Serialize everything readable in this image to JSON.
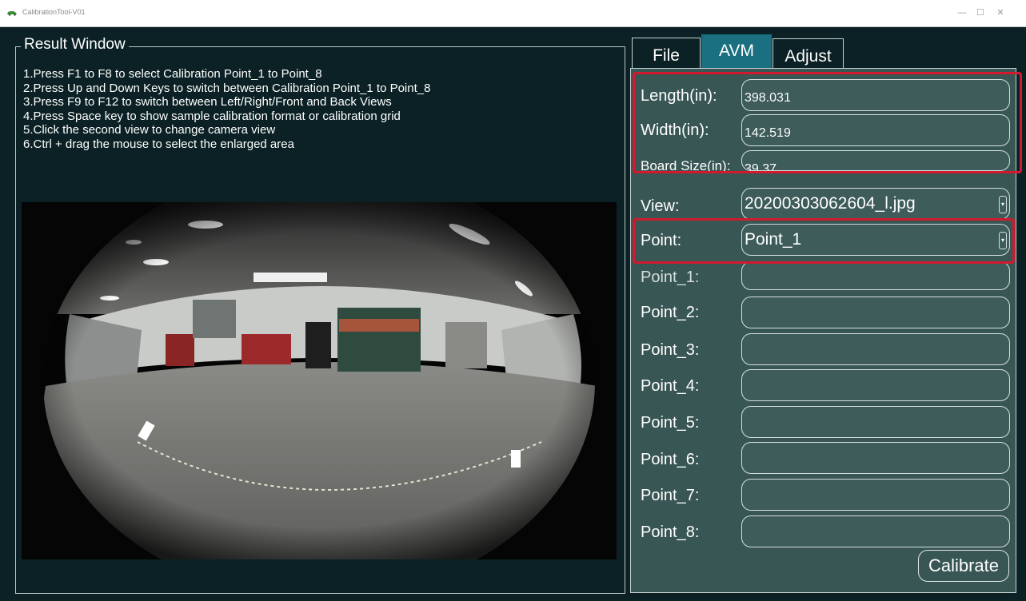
{
  "window": {
    "title": "CalibrationTool-V01",
    "minimize_glyph": "—",
    "maximize_glyph": "☐",
    "close_glyph": "✕"
  },
  "result": {
    "title": "Result Window",
    "instructions": [
      "1.Press F1 to F8 to select Calibration Point_1 to Point_8",
      "2.Press Up and Down Keys to switch between Calibration Point_1 to Point_8",
      "3.Press F9 to F12 to switch between Left/Right/Front and Back Views",
      "4.Press Space key to show sample calibration format or calibration grid",
      "5.Click the second view to change camera view",
      "6.Ctrl + drag the mouse to select the enlarged area"
    ]
  },
  "tabs": [
    {
      "label": "File",
      "active": false
    },
    {
      "label": "AVM",
      "active": true
    },
    {
      "label": "Adjust",
      "active": false
    }
  ],
  "fields": {
    "length": {
      "label": "Length(in):",
      "value": "398.031"
    },
    "width": {
      "label": "Width(in):",
      "value": "142.519"
    },
    "board_size": {
      "label": "Board Size(in):",
      "value": "39.37"
    },
    "view": {
      "label": "View:",
      "value": "20200303062604_l.jpg"
    },
    "point": {
      "label": "Point:",
      "value": "Point_1"
    }
  },
  "points": [
    {
      "label": "Point_1:",
      "value": ""
    },
    {
      "label": "Point_2:",
      "value": ""
    },
    {
      "label": "Point_3:",
      "value": ""
    },
    {
      "label": "Point_4:",
      "value": ""
    },
    {
      "label": "Point_5:",
      "value": ""
    },
    {
      "label": "Point_6:",
      "value": ""
    },
    {
      "label": "Point_7:",
      "value": ""
    },
    {
      "label": "Point_8:",
      "value": ""
    }
  ],
  "calibrate_label": "Calibrate",
  "icons": {
    "app": "car-icon",
    "dropdown": "dropdown-arrow-icon"
  },
  "colors": {
    "background": "#0b2125",
    "panel": "#385654",
    "active_tab": "#1a7080",
    "highlight": "#d11a2e",
    "text": "#ffffff"
  }
}
